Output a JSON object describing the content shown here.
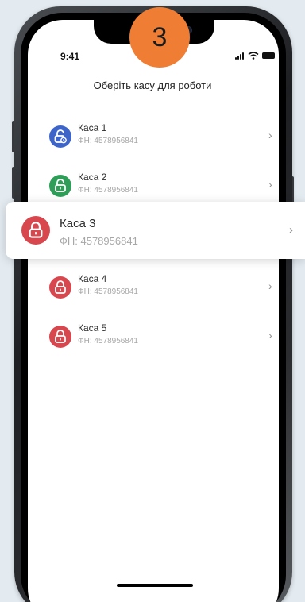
{
  "step_badge": "3",
  "status_bar": {
    "time": "9:41",
    "icons": [
      "signal-icon",
      "wifi-icon",
      "battery-icon"
    ]
  },
  "screen": {
    "title": "Оберіть касу для роботи"
  },
  "registers": [
    {
      "name": "Каса 1",
      "fn": "ФН: 4578956841",
      "icon": "lock-refresh-icon",
      "color": "#3d64c8"
    },
    {
      "name": "Каса 2",
      "fn": "ФН: 4578956841",
      "icon": "lock-open-icon",
      "color": "#2f9e58"
    },
    {
      "name": "Каса 3",
      "fn": "ФН: 4578956841",
      "icon": "lock-icon",
      "color": "#d7474d"
    },
    {
      "name": "Каса 4",
      "fn": "ФН: 4578956841",
      "icon": "lock-icon",
      "color": "#d7474d"
    },
    {
      "name": "Каса 5",
      "fn": "ФН: 4578956841",
      "icon": "lock-icon",
      "color": "#d7474d"
    }
  ],
  "colors": {
    "badge": "#ef7d33",
    "background": "#e3ebf1"
  }
}
